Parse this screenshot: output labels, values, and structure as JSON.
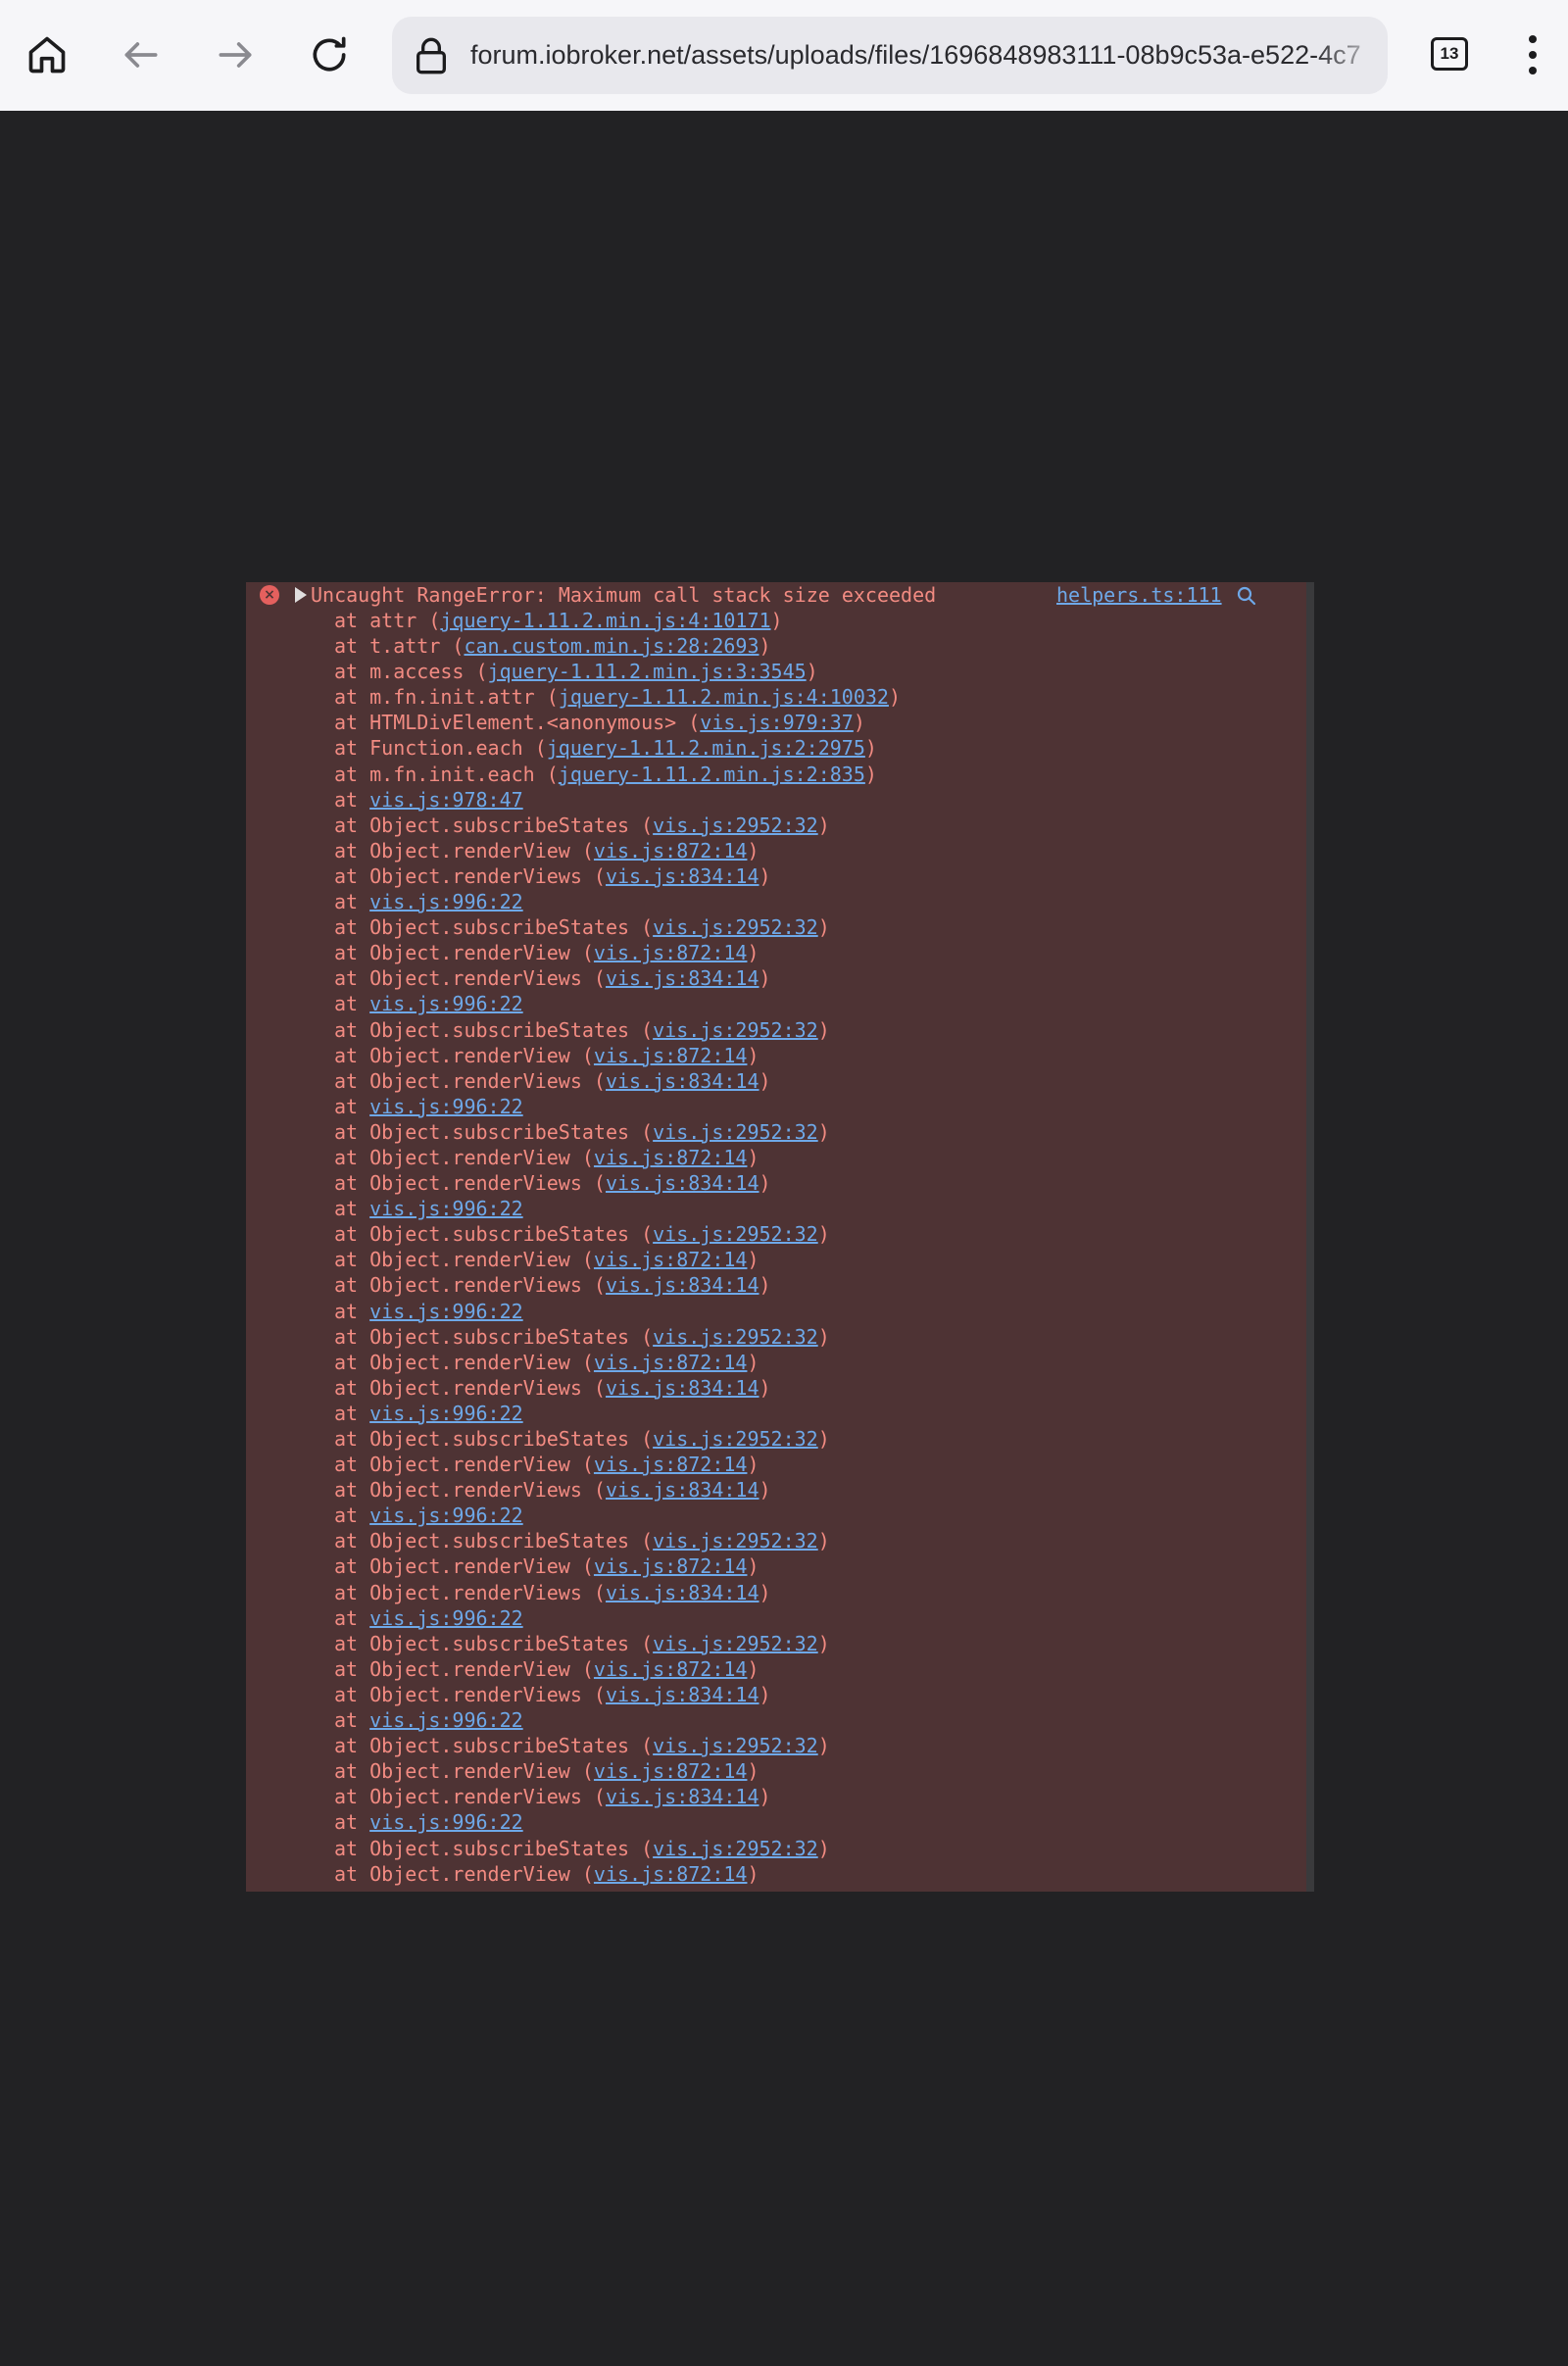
{
  "browser": {
    "url": "forum.iobroker.net/assets/uploads/files/1696848983111-08b9c53a-e522-4c7",
    "tab_count": "13",
    "icons": [
      "home-icon",
      "back-arrow-icon",
      "forward-arrow-icon",
      "reload-icon",
      "lock-icon",
      "tabs-icon",
      "more-vert-icon"
    ]
  },
  "console": {
    "message": "Uncaught RangeError: Maximum call stack size exceeded",
    "source": "helpers.ts:111",
    "colors": {
      "background": "#4e3334",
      "error_text": "#f28b82",
      "link": "#6ea8e8"
    },
    "stack": [
      {
        "prefix": "at ",
        "fn": "attr",
        "loc": "jquery-1.11.2.min.js:4:10171"
      },
      {
        "prefix": "at ",
        "fn": "t.attr",
        "loc": "can.custom.min.js:28:2693"
      },
      {
        "prefix": "at ",
        "fn": "m.access",
        "loc": "jquery-1.11.2.min.js:3:3545"
      },
      {
        "prefix": "at ",
        "fn": "m.fn.init.attr",
        "loc": "jquery-1.11.2.min.js:4:10032"
      },
      {
        "prefix": "at ",
        "fn": "HTMLDivElement.<anonymous>",
        "loc": "vis.js:979:37"
      },
      {
        "prefix": "at ",
        "fn": "Function.each",
        "loc": "jquery-1.11.2.min.js:2:2975"
      },
      {
        "prefix": "at ",
        "fn": "m.fn.init.each",
        "loc": "jquery-1.11.2.min.js:2:835"
      },
      {
        "prefix": "at ",
        "fn": "",
        "loc": "vis.js:978:47"
      },
      {
        "prefix": "at ",
        "fn": "Object.subscribeStates",
        "loc": "vis.js:2952:32"
      },
      {
        "prefix": "at ",
        "fn": "Object.renderView",
        "loc": "vis.js:872:14"
      },
      {
        "prefix": "at ",
        "fn": "Object.renderViews",
        "loc": "vis.js:834:14"
      },
      {
        "prefix": "at ",
        "fn": "",
        "loc": "vis.js:996:22"
      },
      {
        "prefix": "at ",
        "fn": "Object.subscribeStates",
        "loc": "vis.js:2952:32"
      },
      {
        "prefix": "at ",
        "fn": "Object.renderView",
        "loc": "vis.js:872:14"
      },
      {
        "prefix": "at ",
        "fn": "Object.renderViews",
        "loc": "vis.js:834:14"
      },
      {
        "prefix": "at ",
        "fn": "",
        "loc": "vis.js:996:22"
      },
      {
        "prefix": "at ",
        "fn": "Object.subscribeStates",
        "loc": "vis.js:2952:32"
      },
      {
        "prefix": "at ",
        "fn": "Object.renderView",
        "loc": "vis.js:872:14"
      },
      {
        "prefix": "at ",
        "fn": "Object.renderViews",
        "loc": "vis.js:834:14"
      },
      {
        "prefix": "at ",
        "fn": "",
        "loc": "vis.js:996:22"
      },
      {
        "prefix": "at ",
        "fn": "Object.subscribeStates",
        "loc": "vis.js:2952:32"
      },
      {
        "prefix": "at ",
        "fn": "Object.renderView",
        "loc": "vis.js:872:14"
      },
      {
        "prefix": "at ",
        "fn": "Object.renderViews",
        "loc": "vis.js:834:14"
      },
      {
        "prefix": "at ",
        "fn": "",
        "loc": "vis.js:996:22"
      },
      {
        "prefix": "at ",
        "fn": "Object.subscribeStates",
        "loc": "vis.js:2952:32"
      },
      {
        "prefix": "at ",
        "fn": "Object.renderView",
        "loc": "vis.js:872:14"
      },
      {
        "prefix": "at ",
        "fn": "Object.renderViews",
        "loc": "vis.js:834:14"
      },
      {
        "prefix": "at ",
        "fn": "",
        "loc": "vis.js:996:22"
      },
      {
        "prefix": "at ",
        "fn": "Object.subscribeStates",
        "loc": "vis.js:2952:32"
      },
      {
        "prefix": "at ",
        "fn": "Object.renderView",
        "loc": "vis.js:872:14"
      },
      {
        "prefix": "at ",
        "fn": "Object.renderViews",
        "loc": "vis.js:834:14"
      },
      {
        "prefix": "at ",
        "fn": "",
        "loc": "vis.js:996:22"
      },
      {
        "prefix": "at ",
        "fn": "Object.subscribeStates",
        "loc": "vis.js:2952:32"
      },
      {
        "prefix": "at ",
        "fn": "Object.renderView",
        "loc": "vis.js:872:14"
      },
      {
        "prefix": "at ",
        "fn": "Object.renderViews",
        "loc": "vis.js:834:14"
      },
      {
        "prefix": "at ",
        "fn": "",
        "loc": "vis.js:996:22"
      },
      {
        "prefix": "at ",
        "fn": "Object.subscribeStates",
        "loc": "vis.js:2952:32"
      },
      {
        "prefix": "at ",
        "fn": "Object.renderView",
        "loc": "vis.js:872:14"
      },
      {
        "prefix": "at ",
        "fn": "Object.renderViews",
        "loc": "vis.js:834:14"
      },
      {
        "prefix": "at ",
        "fn": "",
        "loc": "vis.js:996:22"
      },
      {
        "prefix": "at ",
        "fn": "Object.subscribeStates",
        "loc": "vis.js:2952:32"
      },
      {
        "prefix": "at ",
        "fn": "Object.renderView",
        "loc": "vis.js:872:14"
      },
      {
        "prefix": "at ",
        "fn": "Object.renderViews",
        "loc": "vis.js:834:14"
      },
      {
        "prefix": "at ",
        "fn": "",
        "loc": "vis.js:996:22"
      },
      {
        "prefix": "at ",
        "fn": "Object.subscribeStates",
        "loc": "vis.js:2952:32"
      },
      {
        "prefix": "at ",
        "fn": "Object.renderView",
        "loc": "vis.js:872:14"
      },
      {
        "prefix": "at ",
        "fn": "Object.renderViews",
        "loc": "vis.js:834:14"
      },
      {
        "prefix": "at ",
        "fn": "",
        "loc": "vis.js:996:22"
      },
      {
        "prefix": "at ",
        "fn": "Object.subscribeStates",
        "loc": "vis.js:2952:32"
      },
      {
        "prefix": "at ",
        "fn": "Object.renderView",
        "loc": "vis.js:872:14"
      }
    ]
  }
}
